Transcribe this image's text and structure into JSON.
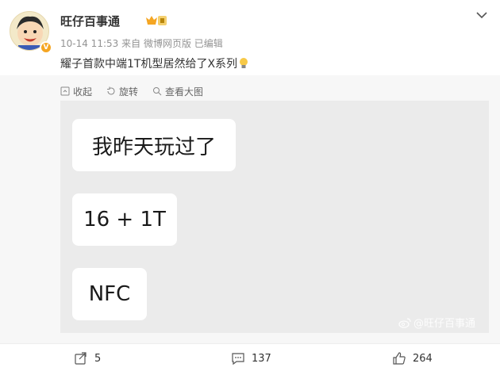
{
  "post": {
    "author": "旺仔百事通",
    "timestamp": "10-14 11:53",
    "source_prefix": "来自",
    "source": "微博网页版",
    "edited": "已编辑",
    "content": "耀子首款中端1T机型居然给了X系列"
  },
  "tools": {
    "collapse": "收起",
    "rotate": "旋转",
    "view_large": "查看大图"
  },
  "image": {
    "bubbles": [
      "我昨天玩过了",
      "16 + 1T",
      "NFC"
    ],
    "watermark": "@旺仔百事通"
  },
  "footer": {
    "shares": "5",
    "comments": "137",
    "likes": "264"
  },
  "colors": {
    "accent": "#f5a623",
    "meta": "#939393",
    "card_bg": "#f7f7f7",
    "image_bg": "#ebebeb"
  },
  "icons": [
    "chevron-down-icon",
    "vip-badge-icon",
    "verified-icon",
    "lightbulb-icon",
    "collapse-icon",
    "rotate-icon",
    "zoom-icon",
    "weibo-logo-icon",
    "share-icon",
    "comment-icon",
    "like-icon"
  ]
}
